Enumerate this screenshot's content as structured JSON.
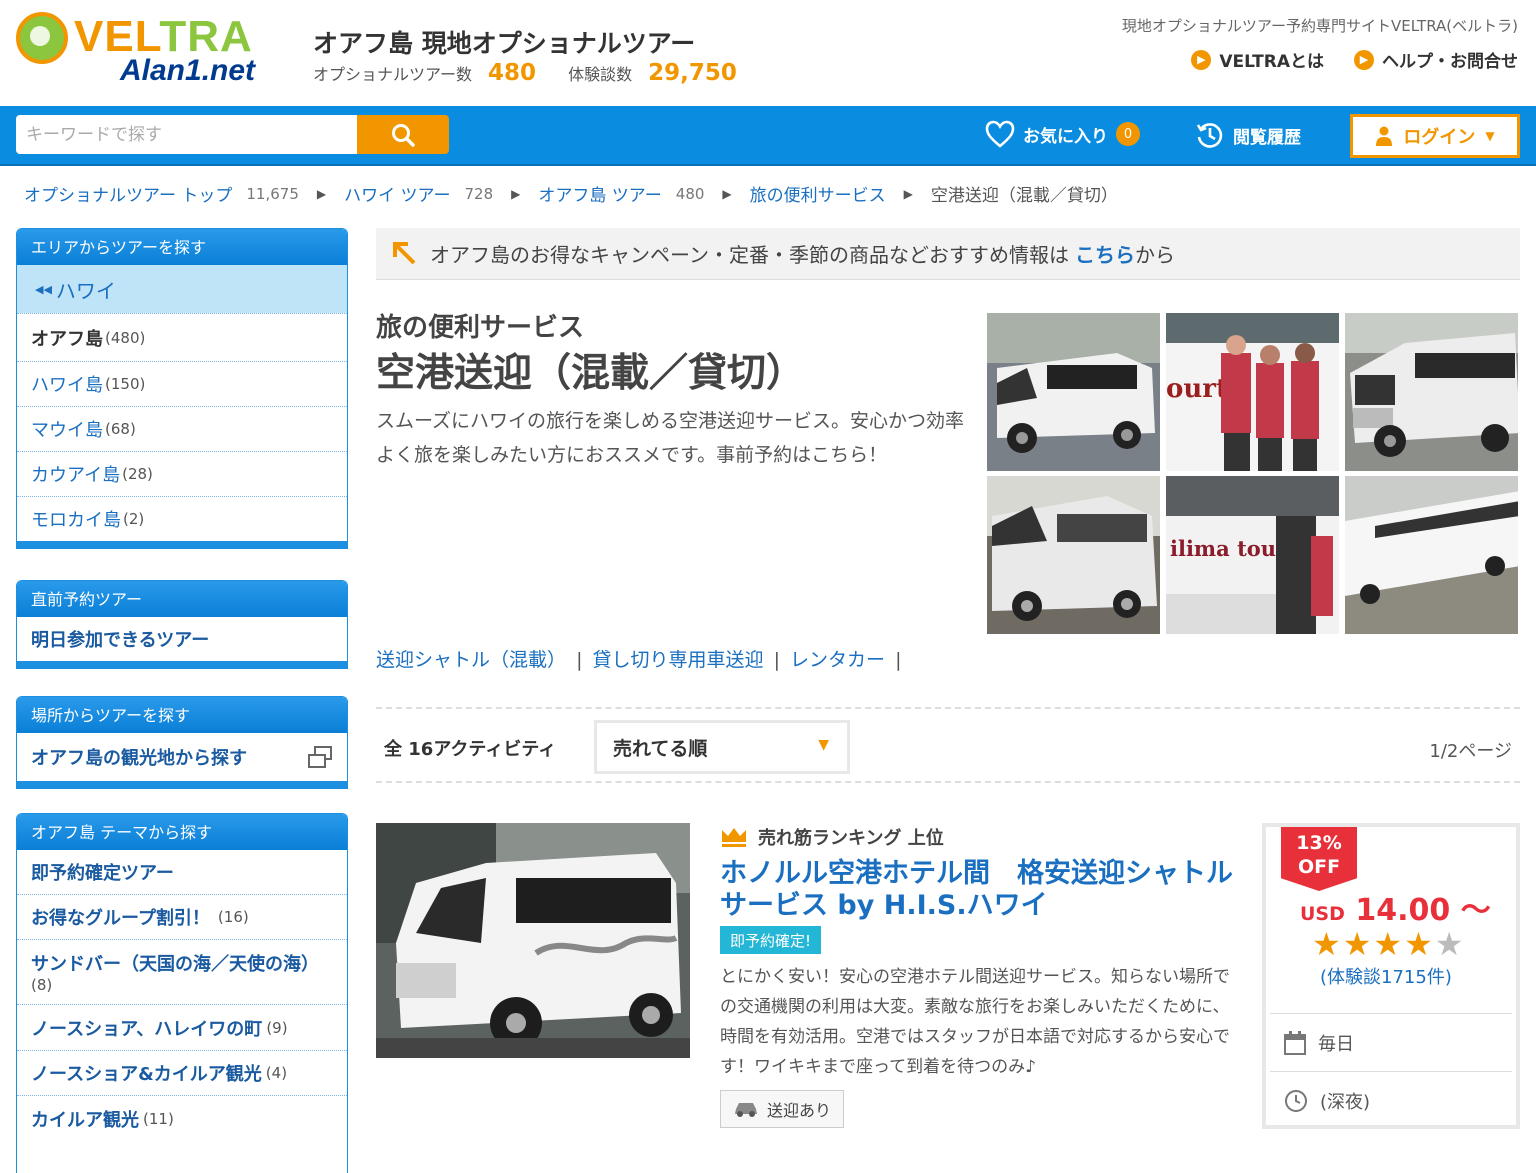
{
  "header": {
    "logo_brand_1": "VEL",
    "logo_brand_2": "TRA",
    "logo_sub": "Alan1.net",
    "site_title": "オアフ島 現地オプショナルツアー",
    "tour_count_label": "オプショナルツアー数",
    "tour_count": "480",
    "review_count_label": "体験談数",
    "review_count": "29,750",
    "tagline": "現地オプショナルツアー予約専門サイトVELTRA(ベルトラ)",
    "link_about": "VELTRAとは",
    "link_help": "ヘルプ・お問合せ"
  },
  "searchbar": {
    "placeholder": "キーワードで探す",
    "favorites_label": "お気に入り",
    "favorites_count": "0",
    "history_label": "閲覧履歴",
    "login_label": "ログイン"
  },
  "breadcrumb": [
    {
      "label": "オプショナルツアー トップ",
      "count": "11,675"
    },
    {
      "label": "ハワイ ツアー",
      "count": "728"
    },
    {
      "label": "オアフ島 ツアー",
      "count": "480"
    },
    {
      "label": "旅の便利サービス",
      "count": ""
    },
    {
      "label": "空港送迎（混載／貸切）",
      "count": ""
    }
  ],
  "sidebar": {
    "area": {
      "heading": "エリアからツアーを探す",
      "region": "ハワイ",
      "items": [
        {
          "label": "オアフ島",
          "count": "(480)"
        },
        {
          "label": "ハワイ島",
          "count": "(150)"
        },
        {
          "label": "マウイ島",
          "count": "(68)"
        },
        {
          "label": "カウアイ島",
          "count": "(28)"
        },
        {
          "label": "モロカイ島",
          "count": "(2)"
        }
      ]
    },
    "last_minute": {
      "heading": "直前予約ツアー",
      "item": "明日参加できるツアー"
    },
    "place": {
      "heading": "場所からツアーを探す",
      "item": "オアフ島の観光地から探す"
    },
    "theme": {
      "heading": "オアフ島 テーマから探す",
      "items": [
        {
          "label": "即予約確定ツアー",
          "count": ""
        },
        {
          "label": "お得なグループ割引！",
          "count": "(16)"
        },
        {
          "label": "サンドバー（天国の海／天使の海）",
          "count": "(8)"
        },
        {
          "label": "ノースショア、ハレイワの町",
          "count": "(9)"
        },
        {
          "label": "ノースショア&カイルア観光",
          "count": "(4)"
        },
        {
          "label": "カイルア観光",
          "count": "(11)"
        }
      ]
    }
  },
  "main": {
    "promo_text_1": "オアフ島のお得なキャンペーン・定番・季節の商品などおすすめ情報は",
    "promo_link": "こちら",
    "promo_text_2": "から",
    "subtitle": "旅の便利サービス",
    "title": "空港送迎（混載／貸切）",
    "description": "スムーズにハワイの旅行を楽しめる空港送迎サービス。安心かつ効率よく旅を楽しみたい方におススメです。事前予約はこちら！",
    "photo_texts": [
      "ourt",
      "ilima tours"
    ],
    "category_links": [
      "送迎シャトル（混載）",
      "貸し切り専用車送迎",
      "レンタカー"
    ],
    "total_label": "全 16アクティビティ",
    "sort_selected": "売れてる順",
    "page_info": "1/2ページ"
  },
  "tour": {
    "rank_label": "売れ筋ランキング 上位",
    "title": "ホノルル空港ホテル間　格安送迎シャトルサービス by H.I.S.ハワイ",
    "instant_badge": "即予約確定!",
    "description": "とにかく安い！安心の空港ホテル間送迎サービス。知らない場所での交通機関の利用は大変。素敵な旅行をお楽しみいただくために、時間を有効活用。空港ではスタッフが日本語で対応するから安心です！ワイキキまで座って到着を待つのみ♪",
    "pickup_tag": "送迎あり",
    "discount_pct": "13%",
    "discount_word": "OFF",
    "currency": "USD",
    "price": "14.00",
    "price_suffix": "～",
    "rating": 4,
    "rating_max": 5,
    "reviews": "(体験談1715件)",
    "schedule": "毎日",
    "time": "(深夜)"
  },
  "colors": {
    "brand_orange": "#f29600",
    "nav_blue": "#0a8de0",
    "link_blue": "#1a6fc0",
    "sale_red": "#e8303a",
    "badge_cyan": "#24b6d6"
  }
}
